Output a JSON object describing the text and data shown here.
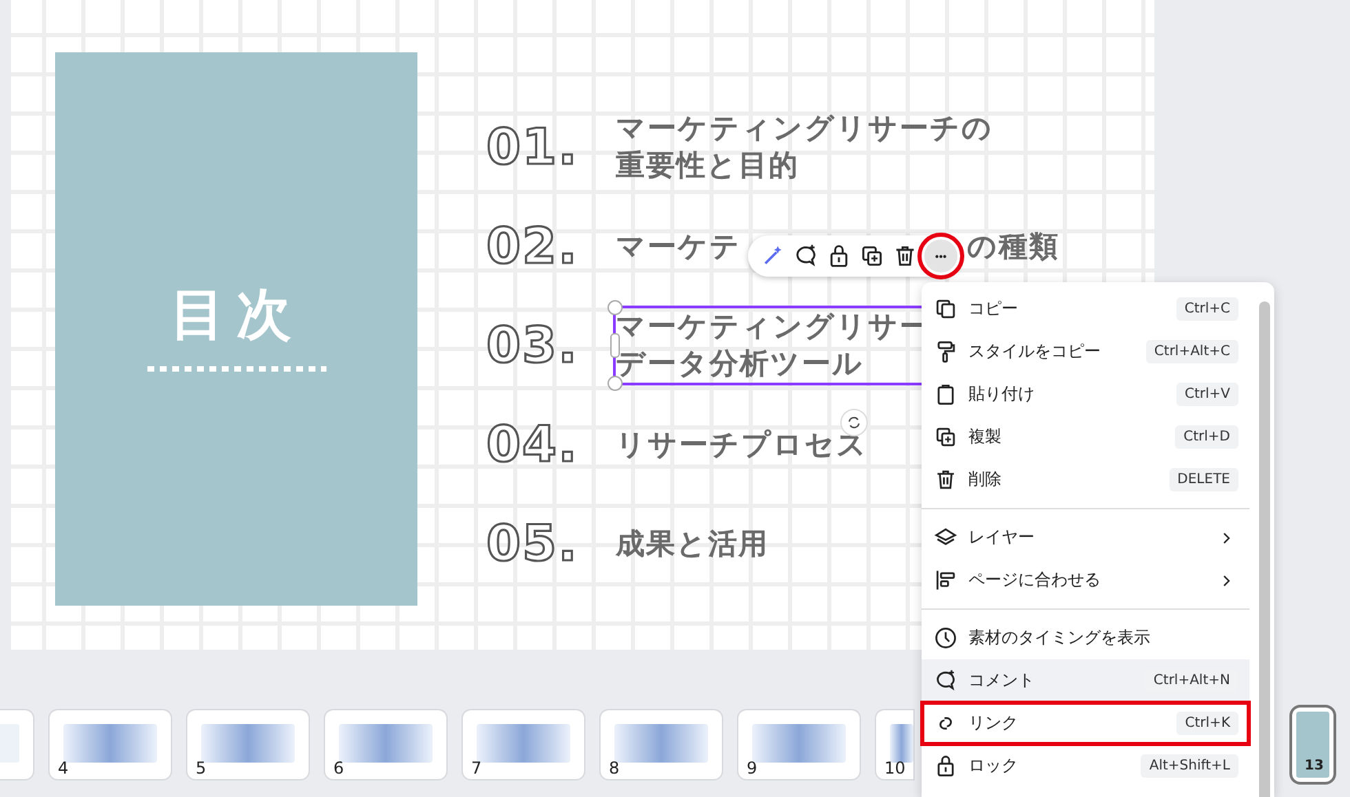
{
  "slide": {
    "panel_title": "目次",
    "items": [
      {
        "number": "01.",
        "lines": [
          "マーケティングリサーチの",
          "重要性と目的"
        ]
      },
      {
        "number": "02.",
        "kind": "split",
        "title_start": "マーケテ",
        "title_end": "の種類"
      },
      {
        "number": "03.",
        "lines": [
          "マーケティングリサー",
          "データ分析ツール"
        ],
        "selected": true
      },
      {
        "number": "04.",
        "lines": [
          "リサーチプロセス"
        ]
      },
      {
        "number": "05.",
        "lines": [
          "成果と活用"
        ]
      }
    ]
  },
  "toolbar": {
    "buttons": [
      {
        "kind": "magic"
      },
      {
        "kind": "comment"
      },
      {
        "kind": "lock"
      },
      {
        "kind": "duplicate"
      },
      {
        "kind": "delete"
      },
      {
        "kind": "more",
        "label": "•••",
        "highlighted": true
      }
    ]
  },
  "context_menu": {
    "groups": [
      [
        {
          "kind": "copy",
          "label": "コピー",
          "shortcut": "Ctrl+C"
        },
        {
          "kind": "roller",
          "label": "スタイルをコピー",
          "shortcut": "Ctrl+Alt+C"
        },
        {
          "kind": "clipboard",
          "label": "貼り付け",
          "shortcut": "Ctrl+V"
        },
        {
          "kind": "duplicate",
          "label": "複製",
          "shortcut": "Ctrl+D"
        },
        {
          "kind": "delete",
          "label": "削除",
          "shortcut": "DELETE"
        }
      ],
      [
        {
          "kind": "layers",
          "label": "レイヤー",
          "submenu": true
        },
        {
          "kind": "align",
          "label": "ページに合わせる",
          "submenu": true
        }
      ],
      [
        {
          "kind": "clock",
          "label": "素材のタイミングを表示"
        },
        {
          "kind": "comment",
          "label": "コメント",
          "shortcut": "Ctrl+Alt+N",
          "hovered": true
        },
        {
          "kind": "link",
          "label": "リンク",
          "shortcut": "Ctrl+K",
          "highlighted": true
        },
        {
          "kind": "lock",
          "label": "ロック",
          "shortcut": "Alt+Shift+L"
        }
      ]
    ]
  },
  "thumbnails": [
    {
      "selected": false,
      "kind": "partial"
    },
    {
      "number": "4",
      "selected": false
    },
    {
      "number": "5",
      "selected": false
    },
    {
      "number": "6",
      "selected": false
    },
    {
      "number": "7",
      "selected": false
    },
    {
      "number": "8",
      "selected": false
    },
    {
      "number": "9",
      "selected": false
    },
    {
      "number": "10",
      "selected": false
    },
    {
      "number": "13",
      "selected": true,
      "kind": "narrow"
    }
  ]
}
